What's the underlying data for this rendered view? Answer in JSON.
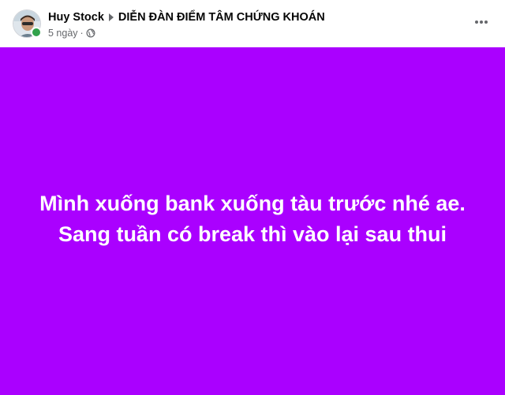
{
  "post": {
    "author": "Huy Stock",
    "group": "DIỄN ĐÀN ĐIỂM TÂM CHỨNG KHOÁN",
    "time": "5 ngày",
    "separator": "·",
    "privacy_icon": "globe-icon",
    "more_icon": "more-horizontal-icon",
    "background_color": "#aa00ff",
    "text_color": "#ffffff",
    "text_lines": [
      "Mình xuống bank xuống tàu trước nhé ae.",
      "Sang tuần có break thì vào lại sau thui"
    ]
  },
  "colors": {
    "online_status": "#31a24c",
    "secondary_text": "#65676b"
  }
}
